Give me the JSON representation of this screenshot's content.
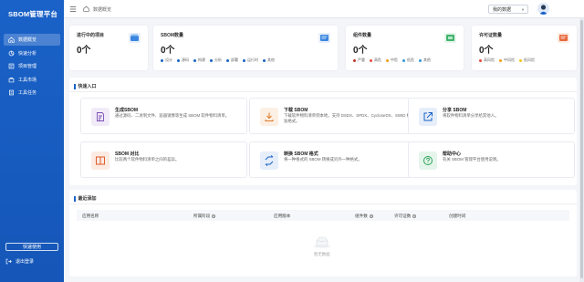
{
  "app": {
    "title": "SBOM管理平台"
  },
  "sidebar": {
    "items": [
      {
        "label": "数据概览",
        "active": true,
        "icon": "home-icon"
      },
      {
        "label": "快速分析",
        "active": false,
        "icon": "analysis-icon"
      },
      {
        "label": "项目管理",
        "active": false,
        "icon": "project-icon"
      },
      {
        "label": "工具市场",
        "active": false,
        "icon": "market-icon"
      },
      {
        "label": "工具任务",
        "active": false,
        "icon": "task-icon"
      }
    ],
    "quick_use": "快速使用",
    "logout": "退出登录"
  },
  "header": {
    "breadcrumb": "数据概览",
    "my_data": "我的数据"
  },
  "stats": [
    {
      "title": "进行中的项目",
      "value": "0个",
      "legend": []
    },
    {
      "title": "SBOM数量",
      "value": "0个",
      "legend": [
        {
          "label": "设计",
          "color": "#1a62c8"
        },
        {
          "label": "源码",
          "color": "#1a62c8"
        },
        {
          "label": "构建",
          "color": "#1a62c8"
        },
        {
          "label": "分析",
          "color": "#1a62c8"
        },
        {
          "label": "部署",
          "color": "#1a62c8"
        },
        {
          "label": "运行时",
          "color": "#1a62c8"
        },
        {
          "label": "其他",
          "color": "#1a62c8"
        }
      ]
    },
    {
      "title": "组件数量",
      "value": "0个",
      "legend": [
        {
          "label": "严重",
          "color": "#c0392b"
        },
        {
          "label": "高危",
          "color": "#e74c3c"
        },
        {
          "label": "中危",
          "color": "#f39c12"
        },
        {
          "label": "低危",
          "color": "#3498db"
        },
        {
          "label": "其他",
          "color": "#3498db"
        }
      ]
    },
    {
      "title": "许可证数量",
      "value": "0个",
      "legend": [
        {
          "label": "高风险",
          "color": "#e74c3c"
        },
        {
          "label": "中风险",
          "color": "#f39c12"
        },
        {
          "label": "低风险",
          "color": "#f1c40f"
        }
      ]
    }
  ],
  "quick": {
    "title": "快速入口",
    "cards": [
      {
        "title": "生成SBOM",
        "desc": "通过源码、二进制文件、容器镜像等生成 SBOM 软件物料清单。",
        "color": "#7b4fb5",
        "bg": "#f1ebf8",
        "icon": "document-edit-icon"
      },
      {
        "title": "下载 SBOM",
        "desc": "下载软件物料清单到本地，支持 DSDX、SPDX、CycloneDX、SWID 标准格式。",
        "color": "#e07b2a",
        "bg": "#fcefe3",
        "icon": "download-icon"
      },
      {
        "title": "分享 SBOM",
        "desc": "将软件物料清单分享给其他人。",
        "color": "#1a62c8",
        "bg": "#e6eefa",
        "icon": "share-icon"
      },
      {
        "title": "SBOM 对比",
        "desc": "比较两个软件物料清单之间的差异。",
        "color": "#e05a2a",
        "bg": "#fcebe3",
        "icon": "compare-icon"
      },
      {
        "title": "转换 SBOM 格式",
        "desc": "将一种格式的 SBOM 转换成另外一种格式。",
        "color": "#1a62c8",
        "bg": "#e6eefa",
        "icon": "convert-icon"
      },
      {
        "title": "帮助中心",
        "desc": "有关 SBOM 管理平台使用说明。",
        "color": "#2fa15a",
        "bg": "#e5f5eb",
        "icon": "help-icon"
      }
    ]
  },
  "recent": {
    "title": "最近添加",
    "columns": [
      "应用名称",
      "所属阶段",
      "应用版本",
      "组件数",
      "许可证数",
      "创建时间"
    ],
    "empty": "暂无数据"
  }
}
